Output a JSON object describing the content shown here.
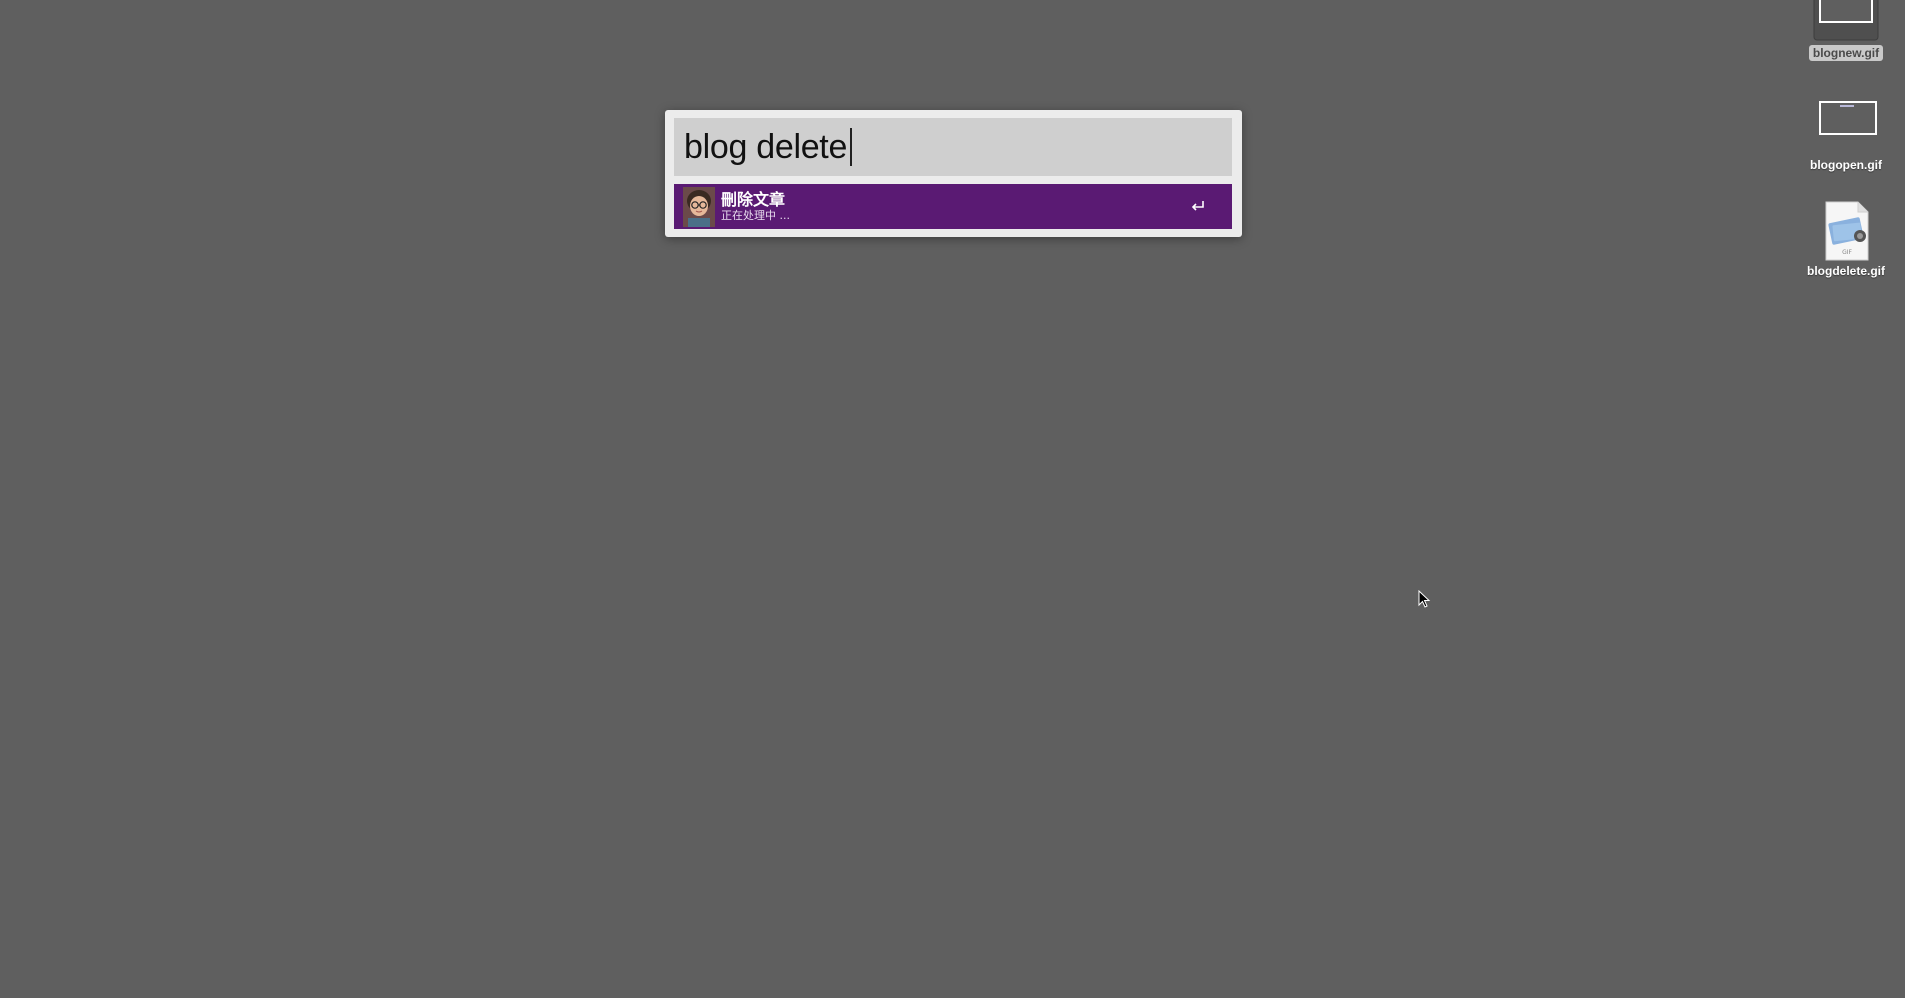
{
  "launcher": {
    "query": "blog delete",
    "results": [
      {
        "title": "刪除文章",
        "subtitle": "正在处理中 ...",
        "action_icon": "return-key-icon",
        "icon": "avatar-icon"
      }
    ],
    "accent_color": "#5a1a73"
  },
  "desktop": {
    "background_color": "#5f5f5f",
    "icons": [
      {
        "label": "blognew.gif",
        "icon": "gif-thumbnail-icon",
        "selected": true
      },
      {
        "label": "blogopen.gif",
        "icon": "gif-thumbnail-icon",
        "selected": false
      },
      {
        "label": "blogdelete.gif",
        "icon": "gif-file-icon",
        "selected": false
      }
    ]
  }
}
